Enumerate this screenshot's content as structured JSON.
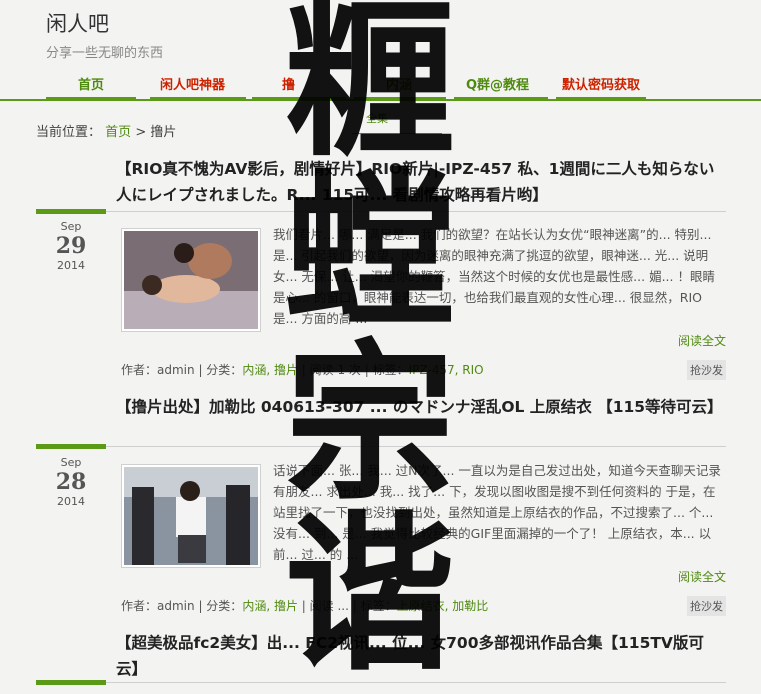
{
  "site": {
    "title": "闲人吧",
    "subtitle": "分享一些无聊的东西"
  },
  "nav": {
    "items": [
      {
        "label": "首页",
        "style": "green"
      },
      {
        "label": "闲人吧神器",
        "style": "red"
      },
      {
        "label": "撸",
        "style": "red"
      },
      {
        "label": "内涵",
        "style": "green"
      },
      {
        "label": "Q群@教程",
        "style": "green"
      },
      {
        "label": "默认密码获取",
        "style": "red"
      }
    ]
  },
  "breadcrumb": {
    "prefix": "当前位置：",
    "home": "首页",
    "sep": ">",
    "current": "撸片"
  },
  "tab": {
    "label": "全集"
  },
  "posts": [
    {
      "title": "【RIO真不愧为AV影后，剧情好片】RIO新片|-IPZ-457 私、1週間に二人も知らない人にレイプされました。R... 115可... 看剧情攻略再看片哟】",
      "date": {
        "month": "Sep",
        "day": "29",
        "year": "2014"
      },
      "excerpt": "我们看片... 哪... 满足是... 我们的欲望？在站长认为女优“眼神迷离”的... 特别... 是... 引起我们的欲望，因为迷离的眼神充满了挑逗的欲望，眼神迷... 光... 说明女... 无保... 让... 渴望你的鞭笞，当然这个时候的女优也是最性感... 媚... ！眼睛是心... 的窗口，眼神能表达一切，也给我们最直观的女性心理... 很显然，RIO是... 方面的高 ...",
      "read_more": "阅读全文",
      "meta": {
        "author_label": "作者：",
        "author": "admin",
        "cat_label": "分类：",
        "cats": "内涵, 撸片",
        "reads": "阅读 1 次",
        "tag_label": "标签：",
        "tags": "IPZ-457, RIO"
      },
      "sofa": "抢沙发"
    },
    {
      "title": "【撸片出处】加勒比 040613-307 ... のマドンナ淫乱OL 上原结衣 【115等待可云】",
      "date": {
        "month": "Sep",
        "day": "28",
        "year": "2014"
      },
      "excerpt": "话说下面... 张... 我... 过N次了... 一直以为是自己发过出处，知道今天查聊天记录有朋友... 求出处... 我... 找了... 下，发现以图收图是搜不到任何资料的 于是，在站里找了一下，也没找到出处，虽然知道是上原结衣的作品，不过搜索了... 个... 没有... 到... 是... 我觉得比较经典的GIF里面漏掉的一个了！ 上原结衣，本... 以前... 过... 的 ...",
      "read_more": "阅读全文",
      "meta": {
        "author_label": "作者：",
        "author": "admin",
        "cat_label": "分类：",
        "cats": "内涵, 撸片",
        "reads": "阅读 ...",
        "tag_label": "标签：",
        "tags": "上原结衣, 加勒比"
      },
      "sofa": "抢沙发"
    },
    {
      "title": "【超美极品fc2美女】出... FC2视讯... 位... 女700多部视讯作品合集【115TV版可云】"
    }
  ],
  "watermark": {
    "chars": [
      "糎",
      "螳",
      "宗",
      "谐"
    ]
  },
  "colors": {
    "accent": "#5a9a16",
    "link": "#4f8a10",
    "nav_red": "#cc2200",
    "background": "#f3f3f1"
  }
}
